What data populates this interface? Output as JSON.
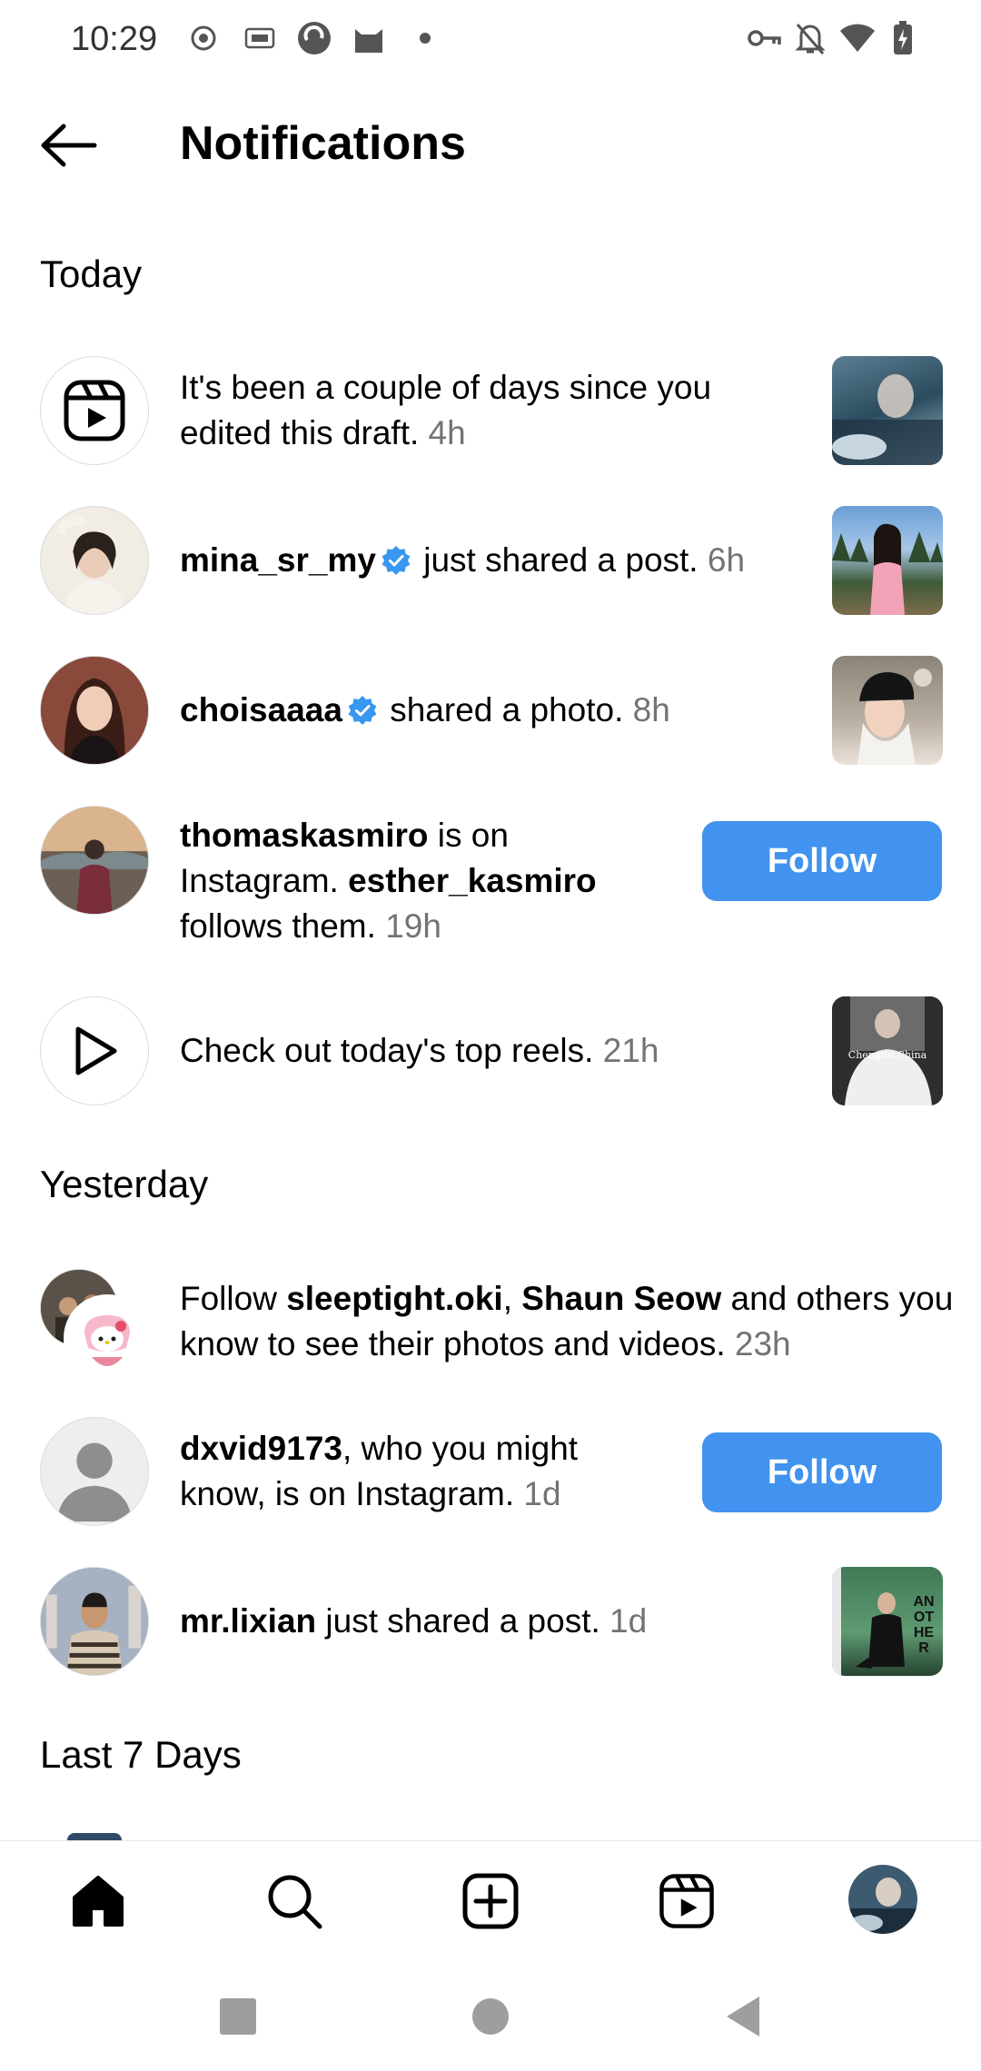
{
  "status_bar": {
    "time": "10:29"
  },
  "header": {
    "title": "Notifications"
  },
  "sections": {
    "today": "Today",
    "yesterday": "Yesterday",
    "last7": "Last 7 Days"
  },
  "notifications": [
    {
      "line1": "It's been a couple of days since you",
      "line2": "edited this draft.",
      "time": "4h"
    },
    {
      "user": "mina_sr_my",
      "text": "just shared a post.",
      "time": "6h"
    },
    {
      "user": "choisaaaa",
      "text": "shared a photo.",
      "time": "8h"
    },
    {
      "user": "thomaskasmiro",
      "text1": "is on",
      "text2": "Instagram.",
      "user2": "esther_kasmiro",
      "text3": "follows them.",
      "time": "19h",
      "button": "Follow"
    },
    {
      "text": "Check out today's top reels.",
      "time": "21h",
      "thumb_caption": "Chengdu China"
    },
    {
      "prefix": "Follow",
      "user1": "sleeptight.oki",
      "sep": ",",
      "user2": "Shaun Seow",
      "text1": "and others you",
      "text2": "know to see their photos and videos.",
      "time": "23h"
    },
    {
      "user": "dxvid9173",
      "text1": ", who you might",
      "text2": "know, is on Instagram.",
      "time": "1d",
      "button": "Follow"
    },
    {
      "user": "mr.lixian",
      "text": "just shared a post.",
      "time": "1d",
      "thumb_caption": "AN OTHER"
    }
  ],
  "nav": [
    "home-icon",
    "search-icon",
    "create-icon",
    "reels-icon",
    "profile-avatar"
  ],
  "colors": {
    "accent": "#4193ef",
    "verified": "#3897f0",
    "muted": "#737373"
  }
}
